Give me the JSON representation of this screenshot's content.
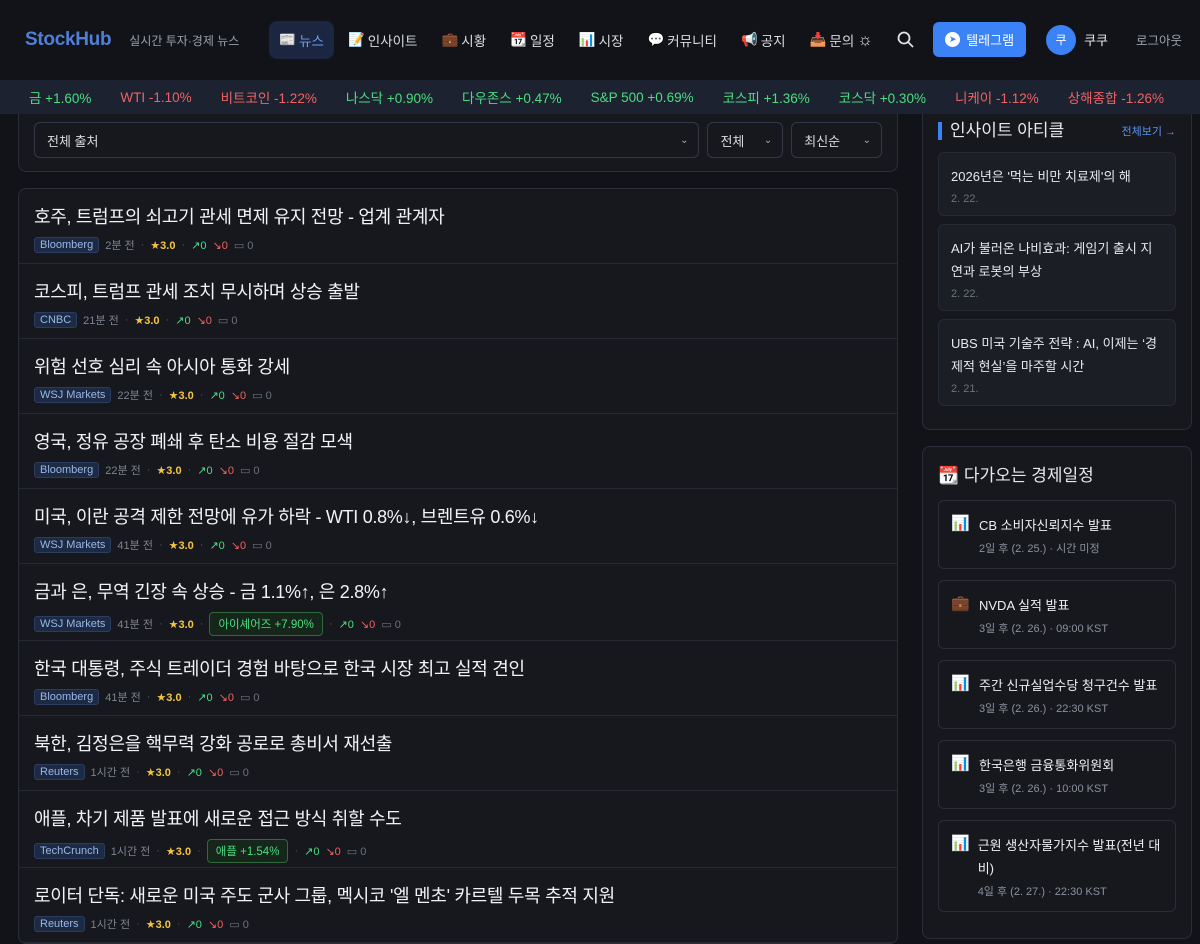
{
  "header": {
    "logo": "StockHub",
    "tagline": "실시간 투자·경제 뉴스",
    "nav": [
      {
        "icon": "📰",
        "label": "뉴스",
        "active": true
      },
      {
        "icon": "📝",
        "label": "인사이트"
      },
      {
        "icon": "💼",
        "label": "시황"
      },
      {
        "icon": "📆",
        "label": "일정"
      },
      {
        "icon": "📊",
        "label": "시장"
      },
      {
        "icon": "💬",
        "label": "커뮤니티"
      },
      {
        "icon": "📢",
        "label": "공지"
      },
      {
        "icon": "📥",
        "label": "문의"
      }
    ],
    "telegram": "텔레그램",
    "avatar": "쿠",
    "username": "쿠쿠",
    "logout": "로그아웃"
  },
  "ticker": [
    {
      "t": "%",
      "dir": "down"
    },
    {
      "t": "금 +1.60%",
      "dir": "up"
    },
    {
      "t": "WTI -1.10%",
      "dir": "down"
    },
    {
      "t": "비트코인 -1.22%",
      "dir": "down"
    },
    {
      "t": "나스닥 +0.90%",
      "dir": "up"
    },
    {
      "t": "다우존스 +0.47%",
      "dir": "up"
    },
    {
      "t": "S&P 500 +0.69%",
      "dir": "up"
    },
    {
      "t": "코스피 +1.36%",
      "dir": "up"
    },
    {
      "t": "코스닥 +0.30%",
      "dir": "up"
    },
    {
      "t": "니케이 -1.12%",
      "dir": "down"
    },
    {
      "t": "상해종합 -1.26%",
      "dir": "down"
    }
  ],
  "filters": {
    "source": "전체 출처",
    "category": "전체",
    "sort": "최신순"
  },
  "news": [
    {
      "title": "호주, 트럼프의 쇠고기 관세 면제 유지 전망 - 업계 관계자",
      "source": "Bloomberg",
      "time": "2분 전",
      "rating": "★3.0",
      "up": "0",
      "down": "0",
      "comments": "0"
    },
    {
      "title": "코스피, 트럼프 관세 조치 무시하며 상승 출발",
      "source": "CNBC",
      "time": "21분 전",
      "rating": "★3.0",
      "up": "0",
      "down": "0",
      "comments": "0"
    },
    {
      "title": "위험 선호 심리 속 아시아 통화 강세",
      "source": "WSJ Markets",
      "time": "22분 전",
      "rating": "★3.0",
      "up": "0",
      "down": "0",
      "comments": "0"
    },
    {
      "title": "영국, 정유 공장 폐쇄 후 탄소 비용 절감 모색",
      "source": "Bloomberg",
      "time": "22분 전",
      "rating": "★3.0",
      "up": "0",
      "down": "0",
      "comments": "0"
    },
    {
      "title": "미국, 이란 공격 제한 전망에 유가 하락 - WTI 0.8%↓, 브렌트유 0.6%↓",
      "source": "WSJ Markets",
      "time": "41분 전",
      "rating": "★3.0",
      "up": "0",
      "down": "0",
      "comments": "0"
    },
    {
      "title": "금과 은, 무역 긴장 속 상승 - 금 1.1%↑, 은 2.8%↑",
      "source": "WSJ Markets",
      "time": "41분 전",
      "rating": "★3.0",
      "chip": "아이셰어즈 +7.90%",
      "up": "0",
      "down": "0",
      "comments": "0"
    },
    {
      "title": "한국 대통령, 주식 트레이더 경험 바탕으로 한국 시장 최고 실적 견인",
      "source": "Bloomberg",
      "time": "41분 전",
      "rating": "★3.0",
      "up": "0",
      "down": "0",
      "comments": "0"
    },
    {
      "title": "북한, 김정은을 핵무력 강화 공로로 총비서 재선출",
      "source": "Reuters",
      "time": "1시간 전",
      "rating": "★3.0",
      "up": "0",
      "down": "0",
      "comments": "0"
    },
    {
      "title": "애플, 차기 제품 발표에 새로운 접근 방식 취할 수도",
      "source": "TechCrunch",
      "time": "1시간 전",
      "rating": "★3.0",
      "chip": "애플 +1.54%",
      "up": "0",
      "down": "0",
      "comments": "0"
    },
    {
      "title": "로이터 단독: 새로운 미국 주도 군사 그룹, 멕시코 '엘 멘초' 카르텔 두목 추적 지원",
      "source": "Reuters",
      "time": "1시간 전",
      "rating": "★3.0",
      "up": "0",
      "down": "0",
      "comments": "0"
    }
  ],
  "insights": {
    "title": "인사이트 아티클",
    "more": "전체보기 →",
    "items": [
      {
        "title": "2026년은 '먹는 비만 치료제'의 해",
        "date": "2. 22."
      },
      {
        "title": "AI가 불러온 나비효과: 게임기 출시 지연과 로봇의 부상",
        "date": "2. 22."
      },
      {
        "title": "UBS 미국 기술주 전략 : AI, 이제는 ‘경제적 현실’을 마주할 시간",
        "date": "2. 21."
      }
    ]
  },
  "schedule": {
    "icon": "📆",
    "title": "다가오는 경제일정",
    "items": [
      {
        "icon": "📊",
        "title": "CB 소비자신뢰지수 발표",
        "when": "2일 후 (2. 25.) · 시간 미정"
      },
      {
        "icon": "💼",
        "title": "NVDA 실적 발표",
        "when": "3일 후 (2. 26.) · 09:00 KST"
      },
      {
        "icon": "📊",
        "title": "주간 신규실업수당 청구건수 발표",
        "when": "3일 후 (2. 26.) · 22:30 KST"
      },
      {
        "icon": "📊",
        "title": "한국은행 금융통화위원회",
        "when": "3일 후 (2. 26.) · 10:00 KST"
      },
      {
        "icon": "📊",
        "title": "근원 생산자물가지수 발표(전년 대비)",
        "when": "4일 후 (2. 27.) · 22:30 KST"
      }
    ]
  }
}
